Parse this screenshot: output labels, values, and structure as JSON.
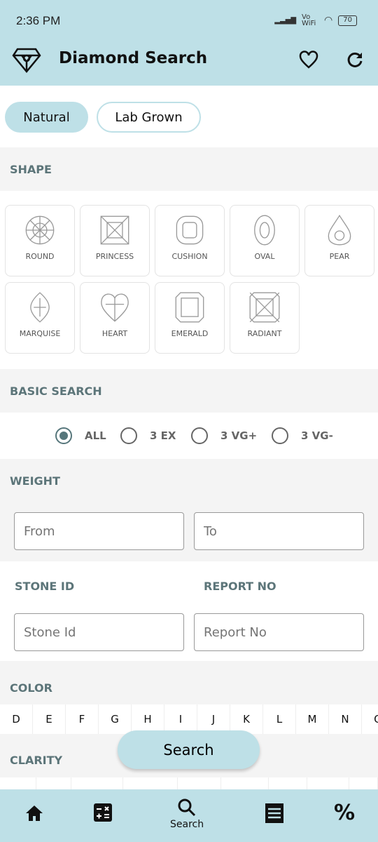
{
  "status": {
    "time": "2:36 PM",
    "network": "Vo WiFi",
    "battery": "70"
  },
  "header": {
    "title": "Diamond Search",
    "logo_icon": "diamond-icon",
    "actions": [
      "heart-icon",
      "refresh-icon"
    ]
  },
  "type_toggle": {
    "options": [
      "Natural",
      "Lab Grown"
    ],
    "selected": "Natural"
  },
  "shape": {
    "title": "SHAPE",
    "items": [
      "ROUND",
      "PRINCESS",
      "CUSHION",
      "OVAL",
      "PEAR",
      "MARQUISE",
      "HEART",
      "EMERALD",
      "RADIANT"
    ]
  },
  "basic_search": {
    "title": "BASIC SEARCH",
    "options": [
      "ALL",
      "3 EX",
      "3 VG+",
      "3 VG-"
    ],
    "selected": "ALL"
  },
  "weight": {
    "title": "WEIGHT",
    "from_placeholder": "From",
    "to_placeholder": "To"
  },
  "ids": {
    "stone_label": "STONE ID",
    "report_label": "REPORT NO",
    "stone_placeholder": "Stone Id",
    "report_placeholder": "Report No"
  },
  "color": {
    "title": "COLOR",
    "items": [
      "D",
      "E",
      "F",
      "G",
      "H",
      "I",
      "J",
      "K",
      "L",
      "M",
      "N",
      "O"
    ]
  },
  "clarity": {
    "title": "CLARITY"
  },
  "search_button": "Search",
  "bottom_nav": {
    "items": [
      {
        "icon": "home-icon"
      },
      {
        "icon": "calculator-icon"
      },
      {
        "icon": "search-icon",
        "label": "Search"
      },
      {
        "icon": "receipt-icon"
      },
      {
        "icon": "percent-icon"
      }
    ],
    "active": "Search"
  },
  "colors": {
    "accent": "#bee0e7",
    "section_text": "#5c7579"
  }
}
